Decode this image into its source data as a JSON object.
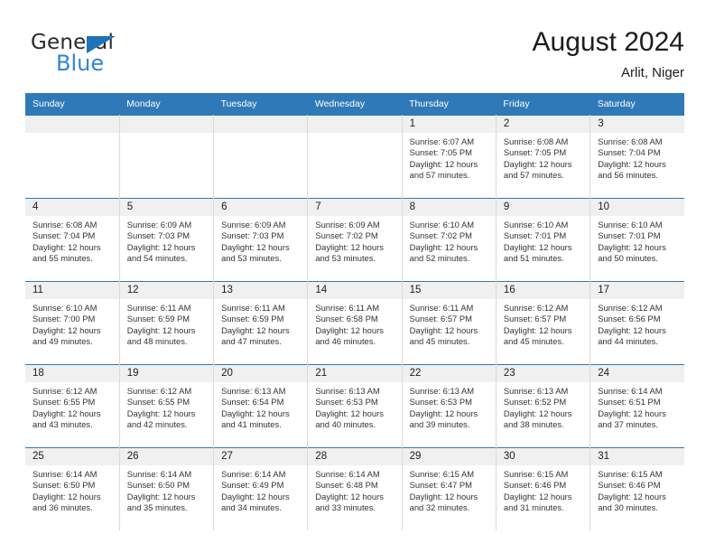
{
  "brand": {
    "name_top": "General",
    "name_bottom": "Blue",
    "accent_color": "#2f86d2",
    "triangle_color": "#1f72b8",
    "top_text_color": "#2b2b2b"
  },
  "header": {
    "title": "August 2024",
    "subtitle": "Arlit, Niger"
  },
  "theme": {
    "header_row_bg": "#3079b8",
    "daynum_band_bg": "#f0f0f0",
    "cell_bg": "#ffffff",
    "row_separator": "#3079b8"
  },
  "weekday_headers": [
    "Sunday",
    "Monday",
    "Tuesday",
    "Wednesday",
    "Thursday",
    "Friday",
    "Saturday"
  ],
  "labels": {
    "sunrise_prefix": "Sunrise:",
    "sunset_prefix": "Sunset:",
    "daylight_prefix": "Daylight:"
  },
  "weeks": [
    [
      {
        "day": "",
        "blank": true,
        "sunrise": "",
        "sunset": "",
        "daylight_line1": "",
        "daylight_line2": ""
      },
      {
        "day": "",
        "blank": true,
        "sunrise": "",
        "sunset": "",
        "daylight_line1": "",
        "daylight_line2": ""
      },
      {
        "day": "",
        "blank": true,
        "sunrise": "",
        "sunset": "",
        "daylight_line1": "",
        "daylight_line2": ""
      },
      {
        "day": "",
        "blank": true,
        "sunrise": "",
        "sunset": "",
        "daylight_line1": "",
        "daylight_line2": ""
      },
      {
        "day": "1",
        "blank": false,
        "sunrise": "Sunrise: 6:07 AM",
        "sunset": "Sunset: 7:05 PM",
        "daylight_line1": "Daylight: 12 hours",
        "daylight_line2": "and 57 minutes."
      },
      {
        "day": "2",
        "blank": false,
        "sunrise": "Sunrise: 6:08 AM",
        "sunset": "Sunset: 7:05 PM",
        "daylight_line1": "Daylight: 12 hours",
        "daylight_line2": "and 57 minutes."
      },
      {
        "day": "3",
        "blank": false,
        "sunrise": "Sunrise: 6:08 AM",
        "sunset": "Sunset: 7:04 PM",
        "daylight_line1": "Daylight: 12 hours",
        "daylight_line2": "and 56 minutes."
      }
    ],
    [
      {
        "day": "4",
        "blank": false,
        "sunrise": "Sunrise: 6:08 AM",
        "sunset": "Sunset: 7:04 PM",
        "daylight_line1": "Daylight: 12 hours",
        "daylight_line2": "and 55 minutes."
      },
      {
        "day": "5",
        "blank": false,
        "sunrise": "Sunrise: 6:09 AM",
        "sunset": "Sunset: 7:03 PM",
        "daylight_line1": "Daylight: 12 hours",
        "daylight_line2": "and 54 minutes."
      },
      {
        "day": "6",
        "blank": false,
        "sunrise": "Sunrise: 6:09 AM",
        "sunset": "Sunset: 7:03 PM",
        "daylight_line1": "Daylight: 12 hours",
        "daylight_line2": "and 53 minutes."
      },
      {
        "day": "7",
        "blank": false,
        "sunrise": "Sunrise: 6:09 AM",
        "sunset": "Sunset: 7:02 PM",
        "daylight_line1": "Daylight: 12 hours",
        "daylight_line2": "and 53 minutes."
      },
      {
        "day": "8",
        "blank": false,
        "sunrise": "Sunrise: 6:10 AM",
        "sunset": "Sunset: 7:02 PM",
        "daylight_line1": "Daylight: 12 hours",
        "daylight_line2": "and 52 minutes."
      },
      {
        "day": "9",
        "blank": false,
        "sunrise": "Sunrise: 6:10 AM",
        "sunset": "Sunset: 7:01 PM",
        "daylight_line1": "Daylight: 12 hours",
        "daylight_line2": "and 51 minutes."
      },
      {
        "day": "10",
        "blank": false,
        "sunrise": "Sunrise: 6:10 AM",
        "sunset": "Sunset: 7:01 PM",
        "daylight_line1": "Daylight: 12 hours",
        "daylight_line2": "and 50 minutes."
      }
    ],
    [
      {
        "day": "11",
        "blank": false,
        "sunrise": "Sunrise: 6:10 AM",
        "sunset": "Sunset: 7:00 PM",
        "daylight_line1": "Daylight: 12 hours",
        "daylight_line2": "and 49 minutes."
      },
      {
        "day": "12",
        "blank": false,
        "sunrise": "Sunrise: 6:11 AM",
        "sunset": "Sunset: 6:59 PM",
        "daylight_line1": "Daylight: 12 hours",
        "daylight_line2": "and 48 minutes."
      },
      {
        "day": "13",
        "blank": false,
        "sunrise": "Sunrise: 6:11 AM",
        "sunset": "Sunset: 6:59 PM",
        "daylight_line1": "Daylight: 12 hours",
        "daylight_line2": "and 47 minutes."
      },
      {
        "day": "14",
        "blank": false,
        "sunrise": "Sunrise: 6:11 AM",
        "sunset": "Sunset: 6:58 PM",
        "daylight_line1": "Daylight: 12 hours",
        "daylight_line2": "and 46 minutes."
      },
      {
        "day": "15",
        "blank": false,
        "sunrise": "Sunrise: 6:11 AM",
        "sunset": "Sunset: 6:57 PM",
        "daylight_line1": "Daylight: 12 hours",
        "daylight_line2": "and 45 minutes."
      },
      {
        "day": "16",
        "blank": false,
        "sunrise": "Sunrise: 6:12 AM",
        "sunset": "Sunset: 6:57 PM",
        "daylight_line1": "Daylight: 12 hours",
        "daylight_line2": "and 45 minutes."
      },
      {
        "day": "17",
        "blank": false,
        "sunrise": "Sunrise: 6:12 AM",
        "sunset": "Sunset: 6:56 PM",
        "daylight_line1": "Daylight: 12 hours",
        "daylight_line2": "and 44 minutes."
      }
    ],
    [
      {
        "day": "18",
        "blank": false,
        "sunrise": "Sunrise: 6:12 AM",
        "sunset": "Sunset: 6:55 PM",
        "daylight_line1": "Daylight: 12 hours",
        "daylight_line2": "and 43 minutes."
      },
      {
        "day": "19",
        "blank": false,
        "sunrise": "Sunrise: 6:12 AM",
        "sunset": "Sunset: 6:55 PM",
        "daylight_line1": "Daylight: 12 hours",
        "daylight_line2": "and 42 minutes."
      },
      {
        "day": "20",
        "blank": false,
        "sunrise": "Sunrise: 6:13 AM",
        "sunset": "Sunset: 6:54 PM",
        "daylight_line1": "Daylight: 12 hours",
        "daylight_line2": "and 41 minutes."
      },
      {
        "day": "21",
        "blank": false,
        "sunrise": "Sunrise: 6:13 AM",
        "sunset": "Sunset: 6:53 PM",
        "daylight_line1": "Daylight: 12 hours",
        "daylight_line2": "and 40 minutes."
      },
      {
        "day": "22",
        "blank": false,
        "sunrise": "Sunrise: 6:13 AM",
        "sunset": "Sunset: 6:53 PM",
        "daylight_line1": "Daylight: 12 hours",
        "daylight_line2": "and 39 minutes."
      },
      {
        "day": "23",
        "blank": false,
        "sunrise": "Sunrise: 6:13 AM",
        "sunset": "Sunset: 6:52 PM",
        "daylight_line1": "Daylight: 12 hours",
        "daylight_line2": "and 38 minutes."
      },
      {
        "day": "24",
        "blank": false,
        "sunrise": "Sunrise: 6:14 AM",
        "sunset": "Sunset: 6:51 PM",
        "daylight_line1": "Daylight: 12 hours",
        "daylight_line2": "and 37 minutes."
      }
    ],
    [
      {
        "day": "25",
        "blank": false,
        "sunrise": "Sunrise: 6:14 AM",
        "sunset": "Sunset: 6:50 PM",
        "daylight_line1": "Daylight: 12 hours",
        "daylight_line2": "and 36 minutes."
      },
      {
        "day": "26",
        "blank": false,
        "sunrise": "Sunrise: 6:14 AM",
        "sunset": "Sunset: 6:50 PM",
        "daylight_line1": "Daylight: 12 hours",
        "daylight_line2": "and 35 minutes."
      },
      {
        "day": "27",
        "blank": false,
        "sunrise": "Sunrise: 6:14 AM",
        "sunset": "Sunset: 6:49 PM",
        "daylight_line1": "Daylight: 12 hours",
        "daylight_line2": "and 34 minutes."
      },
      {
        "day": "28",
        "blank": false,
        "sunrise": "Sunrise: 6:14 AM",
        "sunset": "Sunset: 6:48 PM",
        "daylight_line1": "Daylight: 12 hours",
        "daylight_line2": "and 33 minutes."
      },
      {
        "day": "29",
        "blank": false,
        "sunrise": "Sunrise: 6:15 AM",
        "sunset": "Sunset: 6:47 PM",
        "daylight_line1": "Daylight: 12 hours",
        "daylight_line2": "and 32 minutes."
      },
      {
        "day": "30",
        "blank": false,
        "sunrise": "Sunrise: 6:15 AM",
        "sunset": "Sunset: 6:46 PM",
        "daylight_line1": "Daylight: 12 hours",
        "daylight_line2": "and 31 minutes."
      },
      {
        "day": "31",
        "blank": false,
        "sunrise": "Sunrise: 6:15 AM",
        "sunset": "Sunset: 6:46 PM",
        "daylight_line1": "Daylight: 12 hours",
        "daylight_line2": "and 30 minutes."
      }
    ]
  ]
}
